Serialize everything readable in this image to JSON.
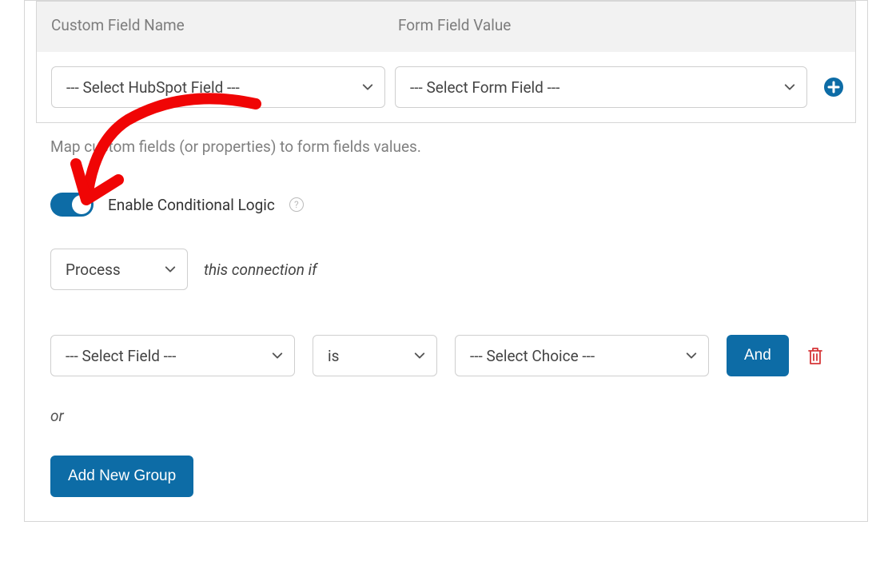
{
  "mapping": {
    "header_col1": "Custom Field Name",
    "header_col2": "Form Field Value",
    "hubspot_placeholder": "--- Select HubSpot Field ---",
    "form_placeholder": "--- Select Form Field ---",
    "help_text": "Map custom fields (or properties) to form fields values."
  },
  "conditional_logic": {
    "toggle_label": "Enable Conditional Logic",
    "toggle_on": true,
    "process_value": "Process",
    "connection_label": "this connection if",
    "field_placeholder": "--- Select Field ---",
    "operator_value": "is",
    "choice_placeholder": "--- Select Choice ---",
    "and_label": "And",
    "or_label": "or",
    "add_group_label": "Add New Group"
  }
}
